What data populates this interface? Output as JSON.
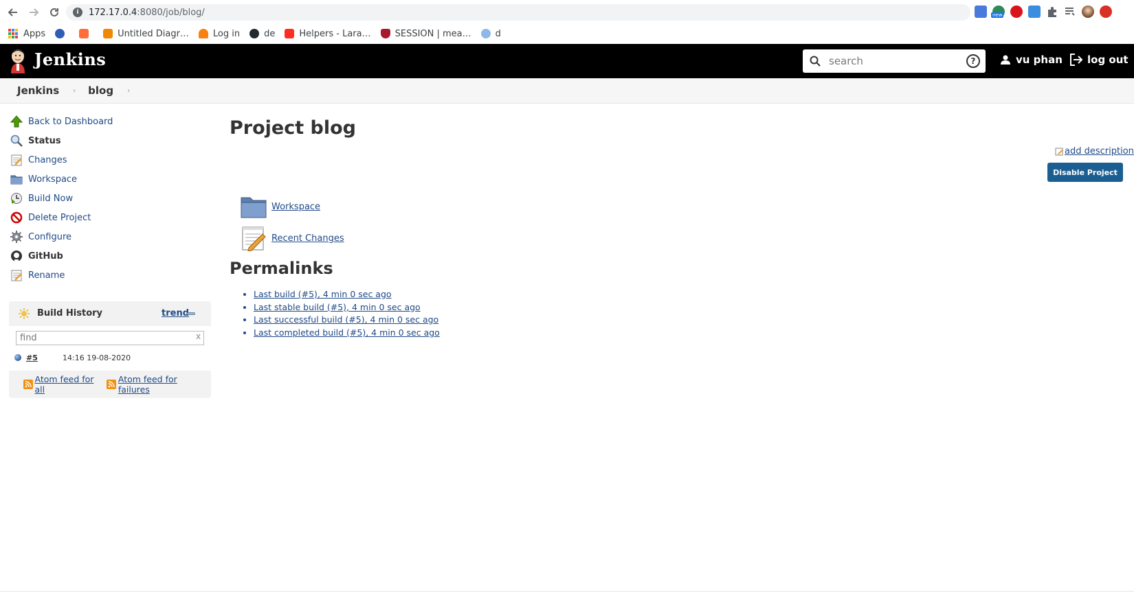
{
  "browser": {
    "url_host": "172.17.0.4",
    "url_path": ":8080/job/blog/",
    "extension_icons": [
      "translate-icon",
      "new-badge-icon",
      "ublock-icon",
      "fi-icon",
      "puzzle-icon",
      "reading-list-icon",
      "profile-avatar-icon",
      "update-icon"
    ],
    "ext_badge": "new"
  },
  "bookmarks": [
    {
      "label": "Apps",
      "icon": "apps-grid-icon"
    },
    {
      "label": "",
      "icon": "s-brand-icon",
      "color": "#2f5fb3"
    },
    {
      "label": "",
      "icon": "orange-square-icon",
      "color": "#ff6d3a"
    },
    {
      "label": "Untitled Diagr…",
      "icon": "drawio-icon",
      "color": "#f08705"
    },
    {
      "label": "Log in",
      "icon": "moodle-icon",
      "color": "#f98012"
    },
    {
      "label": "de",
      "icon": "github-icon",
      "color": "#24292e"
    },
    {
      "label": "Helpers - Lara…",
      "icon": "laravel-icon",
      "color": "#ff2d20"
    },
    {
      "label": "SESSION | mea…",
      "icon": "shield-crest-icon",
      "color": "#a6192e"
    },
    {
      "label": "d",
      "icon": "s-circle-icon",
      "color": "#8fb8e8"
    }
  ],
  "header": {
    "logo_text": "Jenkins",
    "search_placeholder": "search",
    "help_symbol": "?",
    "user_name": "vu phan",
    "logout_label": "log out"
  },
  "breadcrumb": [
    "Jenkins",
    "blog"
  ],
  "tasks": [
    {
      "label": "Back to Dashboard",
      "icon": "up-arrow-icon",
      "active": false
    },
    {
      "label": "Status",
      "icon": "magnifier-icon",
      "active": true
    },
    {
      "label": "Changes",
      "icon": "notepad-icon",
      "active": false
    },
    {
      "label": "Workspace",
      "icon": "folder-icon",
      "active": false
    },
    {
      "label": "Build Now",
      "icon": "clock-play-icon",
      "active": false
    },
    {
      "label": "Delete Project",
      "icon": "no-entry-icon",
      "active": false
    },
    {
      "label": "Configure",
      "icon": "gear-icon",
      "active": false
    },
    {
      "label": "GitHub",
      "icon": "github-icon",
      "active": true
    },
    {
      "label": "Rename",
      "icon": "notepad-icon",
      "active": false
    }
  ],
  "build_history": {
    "title": "Build History",
    "trend": "trend",
    "find_placeholder": "find",
    "clear": "x",
    "builds": [
      {
        "number": "#5",
        "time": "14:16 19-08-2020",
        "status": "blue"
      }
    ],
    "feed_all": "Atom feed for all",
    "feed_failures": "Atom feed for failures"
  },
  "main": {
    "title": "Project blog",
    "add_description": "add description",
    "disable_button": "Disable Project",
    "links": [
      {
        "label": "Workspace",
        "icon": "folder-icon"
      },
      {
        "label": "Recent Changes",
        "icon": "notepad-icon"
      }
    ],
    "permalinks_title": "Permalinks",
    "permalinks": [
      "Last build (#5), 4 min 0 sec ago",
      "Last stable build (#5), 4 min 0 sec ago",
      "Last successful build (#5), 4 min 0 sec ago",
      "Last completed build (#5), 4 min 0 sec ago"
    ]
  },
  "colors": {
    "header_bg": "#000000",
    "link": "#204a87",
    "button_primary": "#1b5e91",
    "feed_orange": "#f29111"
  }
}
